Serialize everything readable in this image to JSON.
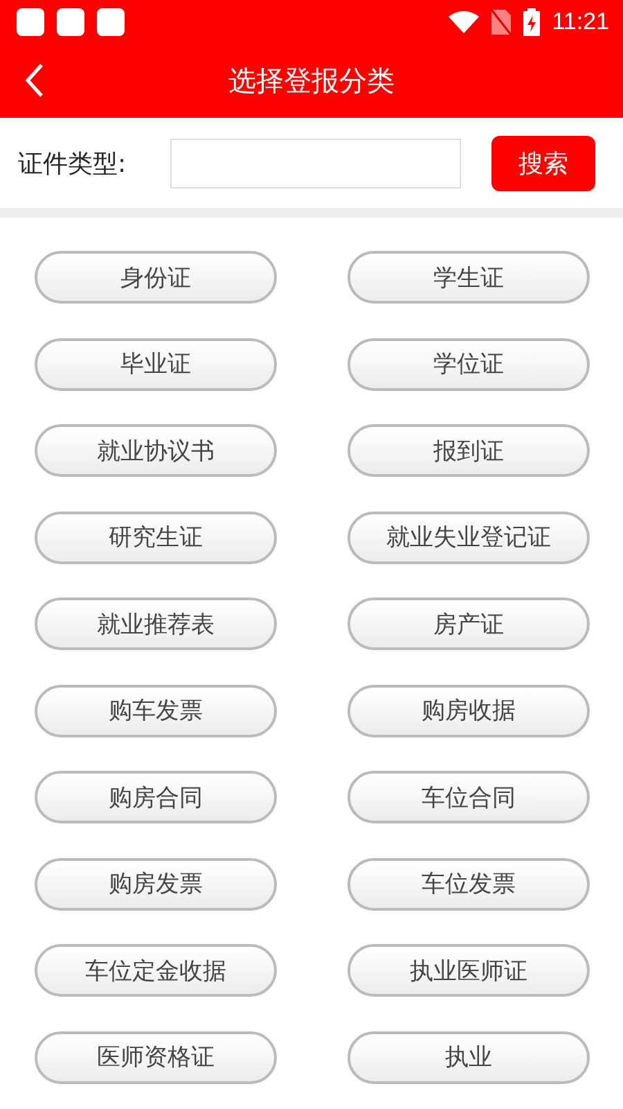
{
  "status_bar": {
    "time": "11:21"
  },
  "header": {
    "title": "选择登报分类"
  },
  "search": {
    "label": "证件类型:",
    "button": "搜索"
  },
  "categories": [
    {
      "label": "身份证"
    },
    {
      "label": "学生证"
    },
    {
      "label": "毕业证"
    },
    {
      "label": "学位证"
    },
    {
      "label": "就业协议书"
    },
    {
      "label": "报到证"
    },
    {
      "label": "研究生证"
    },
    {
      "label": "就业失业登记证"
    },
    {
      "label": "就业推荐表"
    },
    {
      "label": "房产证"
    },
    {
      "label": "购车发票"
    },
    {
      "label": "购房收据"
    },
    {
      "label": "购房合同"
    },
    {
      "label": "车位合同"
    },
    {
      "label": "购房发票"
    },
    {
      "label": "车位发票"
    },
    {
      "label": "车位定金收据"
    },
    {
      "label": "执业医师证"
    },
    {
      "label": "医师资格证"
    },
    {
      "label": "执业"
    }
  ]
}
